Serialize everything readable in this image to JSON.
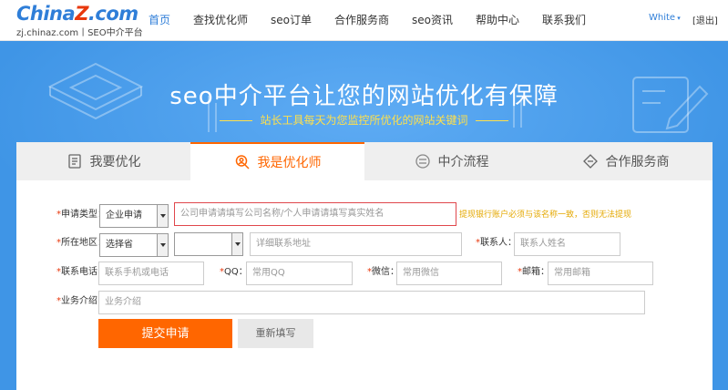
{
  "header": {
    "logo_text_1": "China",
    "logo_text_2": "Z",
    "logo_text_3": ".com",
    "logo_subtitle": "zj.chinaz.com丨SEO中介平台",
    "nav": [
      "首页",
      "查找优化师",
      "seo订单",
      "合作服务商",
      "seo资讯",
      "帮助中心",
      "联系我们"
    ],
    "active_nav": 0,
    "user_label": "White",
    "logout_label": "[退出]"
  },
  "banner": {
    "title": "seo中介平台让您的网站优化有保障",
    "subtitle": "站长工具每天为您监控所优化的网站关键词"
  },
  "tabs": [
    {
      "label": "我要优化",
      "icon": "document-icon"
    },
    {
      "label": "我是优化师",
      "icon": "user-search-icon"
    },
    {
      "label": "中介流程",
      "icon": "flow-icon"
    },
    {
      "label": "合作服务商",
      "icon": "handshake-icon"
    }
  ],
  "form": {
    "type_label": "申请类型：",
    "type_value": "企业申请",
    "name_placeholder": "公司申请请填写公司名称/个人申请请填写真实姓名",
    "name_hint": "提现银行账户必须与该名称一致，否则无法提现",
    "region_label": "所在地区：",
    "province_value": "选择省",
    "city_value": "",
    "address_placeholder": "详细联系地址",
    "contact_label": "联系人：",
    "contact_placeholder": "联系人姓名",
    "phone_label": "联系电话：",
    "phone_placeholder": "联系手机或电话",
    "qq_label": "QQ：",
    "qq_placeholder": "常用QQ",
    "wechat_label": "微信：",
    "wechat_placeholder": "常用微信",
    "email_label": "邮箱：",
    "email_placeholder": "常用邮箱",
    "biz_label": "业务介绍：",
    "biz_placeholder": "业务介绍",
    "submit_label": "提交申请",
    "reset_label": "重新填写"
  },
  "colors": {
    "brand_blue": "#2f7ed8",
    "banner_blue": "#3f95e6",
    "accent_orange": "#ff6600",
    "hint_yellow": "#e4a800",
    "required_red": "#e8380d"
  }
}
